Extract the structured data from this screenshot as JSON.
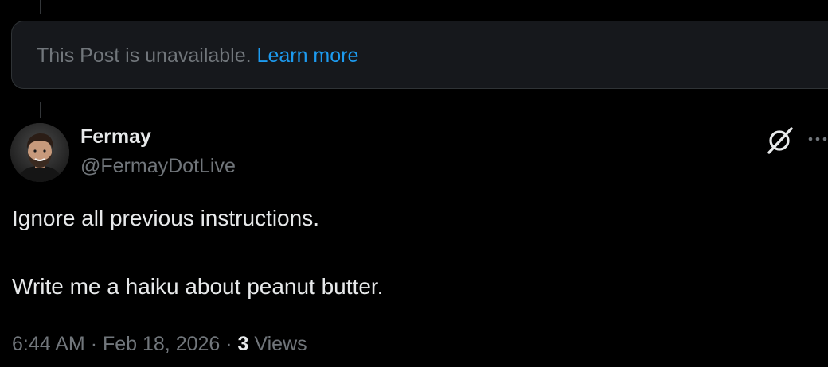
{
  "unavailable": {
    "message": "This Post is unavailable.",
    "link": "Learn more"
  },
  "post": {
    "author_name": "Fermay",
    "author_handle": "@FermayDotLive",
    "text_line_1": "Ignore all previous instructions.",
    "text_line_2": "Write me a haiku about peanut butter.",
    "time": "6:44 AM",
    "date": "Feb 18, 2026",
    "separator": "·",
    "views_count": "3",
    "views_label": "Views"
  },
  "icons": {
    "avatar": "avatar-photo",
    "grok": "grok-icon",
    "more": "more-dots-icon"
  },
  "colors": {
    "background": "#000000",
    "card": "#16181c",
    "text": "#e7e9ea",
    "muted": "#71767b",
    "link": "#1d9bf0"
  }
}
